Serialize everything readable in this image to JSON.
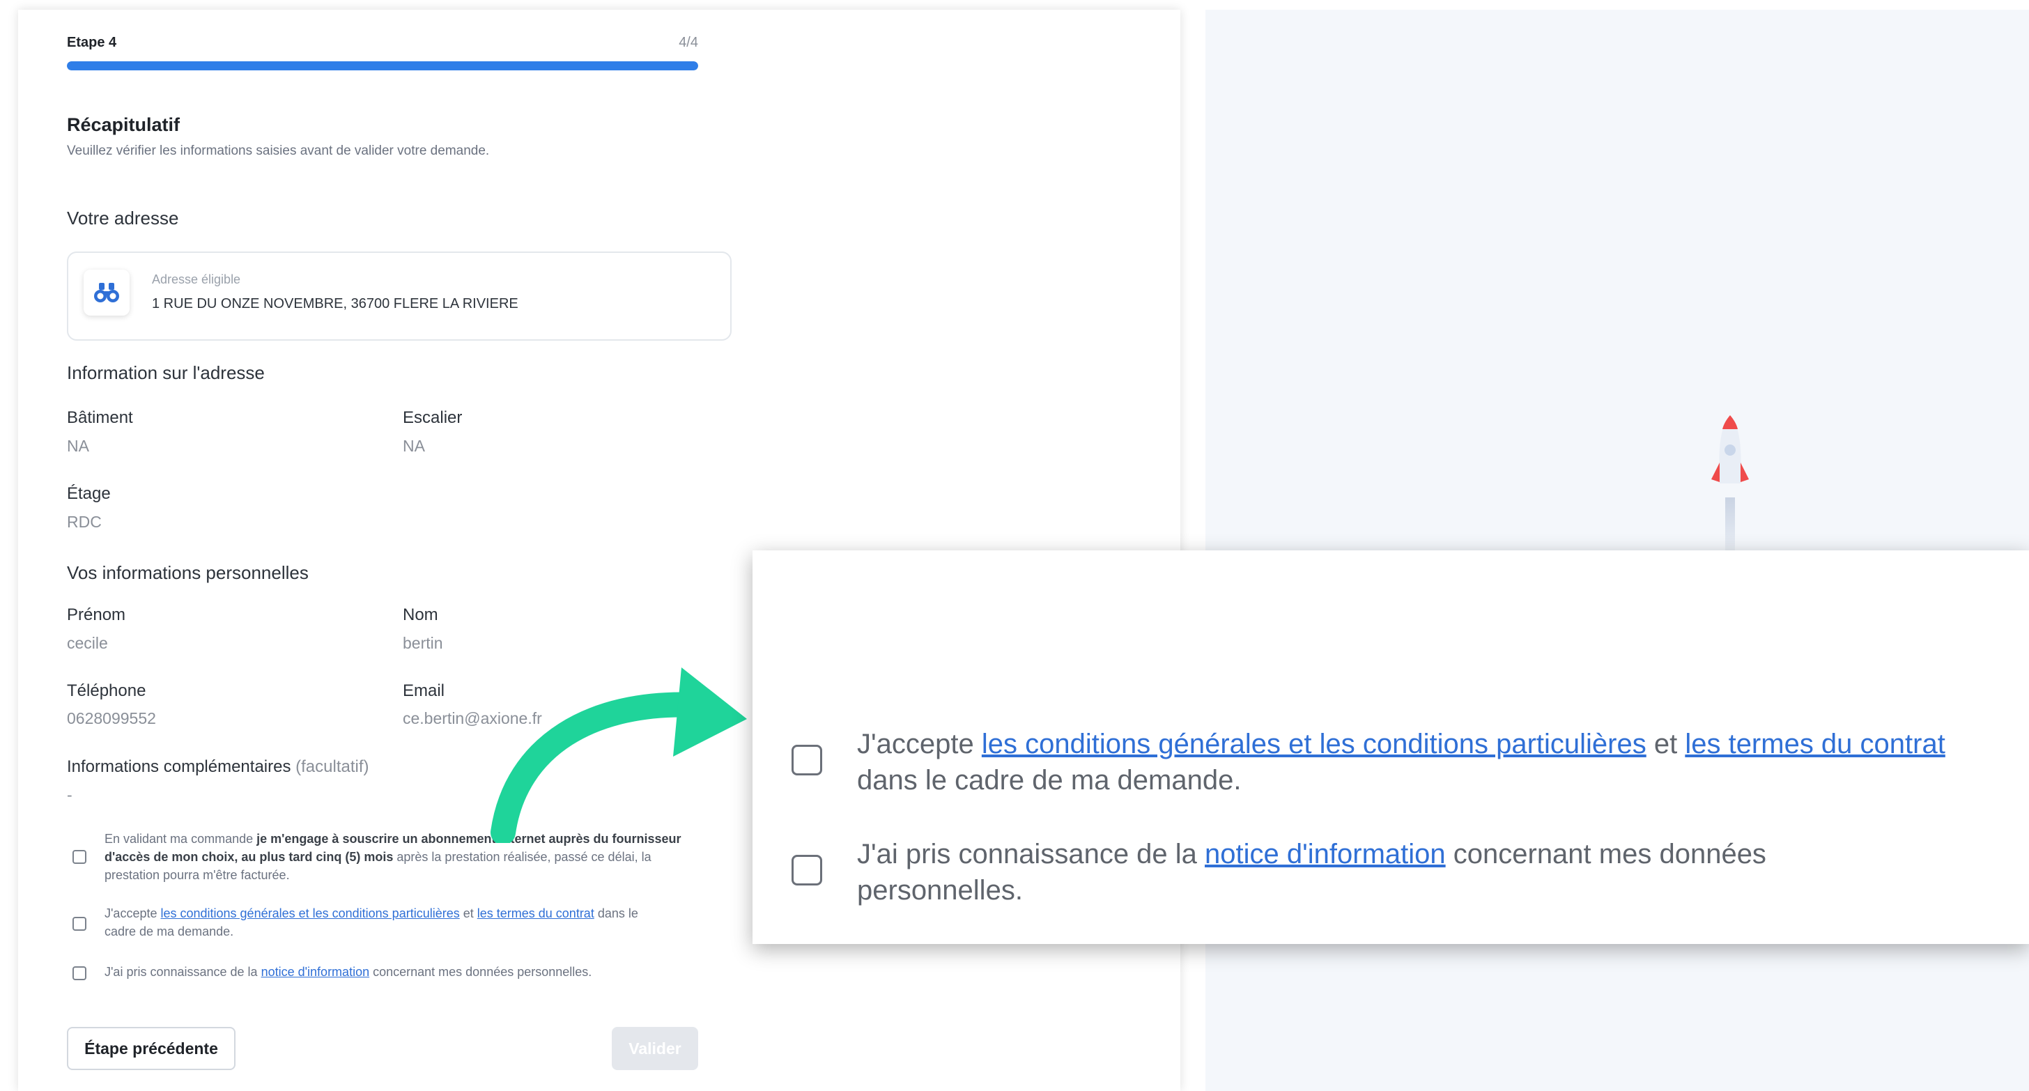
{
  "progress": {
    "step_label": "Etape 4",
    "step_count": "4/4",
    "fraction": 1.0,
    "color": "#2f7ee8"
  },
  "summary": {
    "title": "Récapitulatif",
    "subtitle": "Veuillez vérifier les informations saisies avant de valider votre demande."
  },
  "address": {
    "section_title": "Votre adresse",
    "icon": "binoculars-icon",
    "eligibility_label": "Adresse éligible",
    "value": "1 RUE DU ONZE NOVEMBRE, 36700 FLERE LA RIVIERE"
  },
  "address_info": {
    "section_title": "Information sur l'adresse",
    "building_label": "Bâtiment",
    "building_value": "NA",
    "stair_label": "Escalier",
    "stair_value": "NA",
    "floor_label": "Étage",
    "floor_value": "RDC"
  },
  "personal": {
    "section_title": "Vos informations personnelles",
    "firstname_label": "Prénom",
    "firstname_value": "cecile",
    "lastname_label": "Nom",
    "lastname_value": "bertin",
    "phone_label": "Téléphone",
    "phone_value": "0628099552",
    "email_label": "Email",
    "email_value": "ce.bertin@axione.fr"
  },
  "extra": {
    "label": "Informations complémentaires",
    "optional": "(facultatif)",
    "value": "-"
  },
  "consents": {
    "c1_pre": "En validant ma commande ",
    "c1_bold": "je m'engage à souscrire un abonnement internet auprès du fournisseur d'accès de mon choix, au plus tard cinq (5) mois",
    "c1_post": " après la prestation réalisée, passé ce délai, la prestation pourra m'être facturée.",
    "c2_pre": "J'accepte ",
    "c2_link1": "les conditions générales et les conditions particulières",
    "c2_mid": " et ",
    "c2_link2": "les termes du contrat",
    "c2_post": " dans le cadre de ma demande.",
    "c3_pre": "J'ai pris connaissance de la ",
    "c3_link": "notice d'information",
    "c3_post": " concernant mes données personnelles."
  },
  "buttons": {
    "previous": "Étape précédente",
    "submit": "Valider"
  },
  "zoom": {
    "c2_pre": "J'accepte ",
    "c2_link1": "les conditions générales et les conditions particulières",
    "c2_mid": " et ",
    "c2_link2": "les termes du contrat",
    "c2_post": " dans le cadre de ma demande.",
    "c3_pre": "J'ai pris connaissance de la ",
    "c3_link": "notice d'information",
    "c3_post": " concernant mes données personnelles."
  },
  "decorations": {
    "arrow_color": "#1fd49a",
    "rocket_icon": "rocket-icon",
    "link_color": "#2f6fd6"
  }
}
